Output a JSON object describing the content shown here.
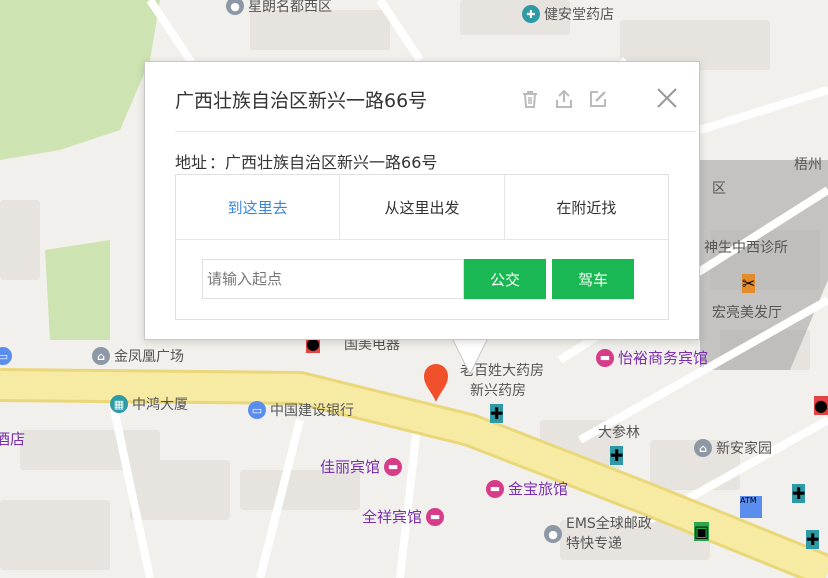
{
  "popup": {
    "title": "广西壮族自治区新兴一路66号",
    "address_label": "地址",
    "address_sep": "：",
    "address": "广西壮族自治区新兴一路66号",
    "tabs": [
      "到这里去",
      "从这里出发",
      "在附近找"
    ],
    "active_tab": 0,
    "start_placeholder": "请输入起点",
    "bus_label": "公交",
    "car_label": "驾车",
    "tool_icons": [
      "trash-icon",
      "share-icon",
      "edit-icon"
    ]
  },
  "map": {
    "labels": {
      "xinglang": "星朗名都西区",
      "jianan": "健安堂药店",
      "wuzhou": "梧州",
      "qu": "区",
      "shenzhongxi": "神生中西诊所",
      "hongliang": "宏亮美发厅",
      "yiyu": "怡裕商务宾馆",
      "laibaixing": "老百姓大药房",
      "xinxing": "新兴药房",
      "dashenlin": "大参林",
      "xinanjia": "新安家园",
      "jinfenghuang": "金凤凰广场",
      "yinhang": "银行",
      "zhonghong": "中鸿大厦",
      "jianshe": "中国建设银行",
      "dajiudian": "大酒店",
      "jiali": "佳丽宾馆",
      "jinbao": "金宝旅馆",
      "quanxiang": "全祥宾馆",
      "ems": "EMS全球邮政",
      "ems2": "特快专递",
      "guomei": "国美电器",
      "atm": "ATM"
    }
  },
  "colors": {
    "accent": "#3a87d8",
    "button": "#1ab852",
    "marker": "#f0502a",
    "road": "#f7eba3"
  }
}
